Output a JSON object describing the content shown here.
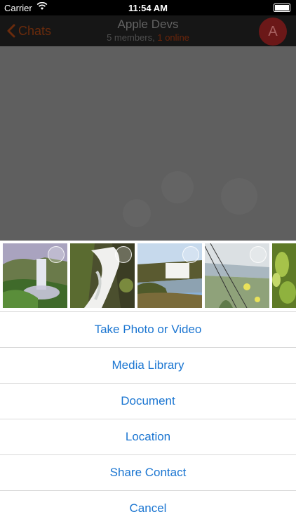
{
  "status_bar": {
    "carrier": "Carrier",
    "time": "11:54 AM"
  },
  "nav": {
    "back_label": "Chats",
    "title": "Apple Devs",
    "members": "5 members,",
    "online": "1 online",
    "avatar_letter": "A"
  },
  "photo_strip": {
    "thumbnails": [
      {
        "name": "waterfall-mist"
      },
      {
        "name": "waterfall-rocks"
      },
      {
        "name": "waterfall-canyon"
      },
      {
        "name": "coast-flowers"
      },
      {
        "name": "green-leaves"
      }
    ]
  },
  "actions": {
    "take_photo": "Take Photo or Video",
    "media_library": "Media Library",
    "document": "Document",
    "location": "Location",
    "share_contact": "Share Contact",
    "cancel": "Cancel"
  },
  "colors": {
    "action_text": "#1a75d1",
    "accent_dimmed": "#6b250b",
    "overlay": "#5f5f5f"
  }
}
